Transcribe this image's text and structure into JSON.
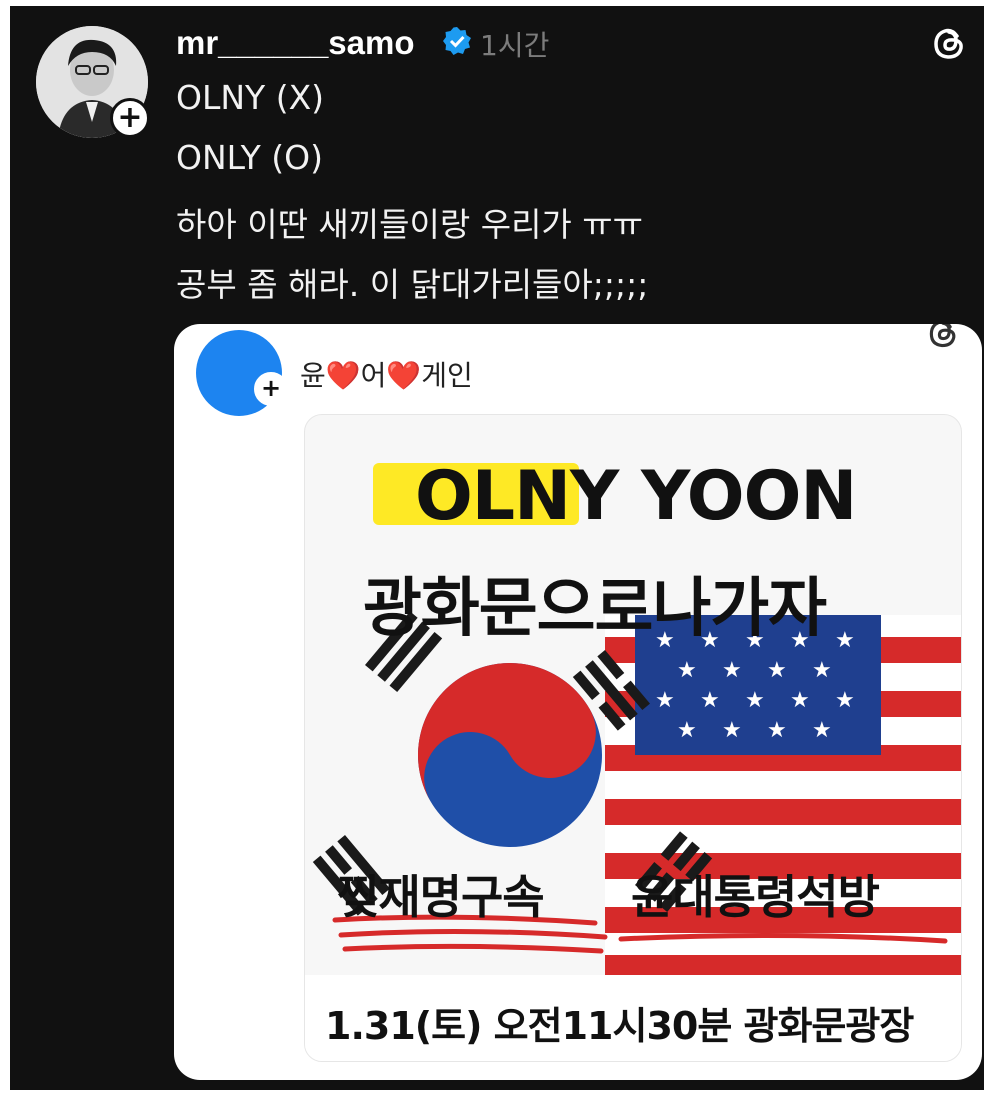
{
  "post": {
    "username": "mr______samo",
    "time": "1시간",
    "lines": [
      "OLNY (X)",
      "ONLY (O)",
      "하아 이딴 새끼들이랑 우리가 ㅠㅠ",
      "공부 좀 해라. 이 닭대가리들아;;;;;"
    ]
  },
  "quote": {
    "text_a": "윤",
    "text_b": "어",
    "text_c": "게인",
    "heart": "❤️",
    "poster": {
      "headline_a": "OLNY",
      "headline_b": "YOON",
      "subhead": "광화문으로나가자",
      "left_slogan": "찢재명구속",
      "right_slogan": "윤대통령석방",
      "footer": "1.31(토) 오전11시30분 광화문광장"
    }
  },
  "colors": {
    "background": "#111111",
    "verified": "#1d9bf0",
    "card": "#ffffff",
    "accent_red": "#d62a2a",
    "accent_blue": "#1f4fa8",
    "highlight": "#ffe600"
  },
  "icons": [
    "verified-badge-icon",
    "threads-logo-icon",
    "follow-plus-icon"
  ]
}
